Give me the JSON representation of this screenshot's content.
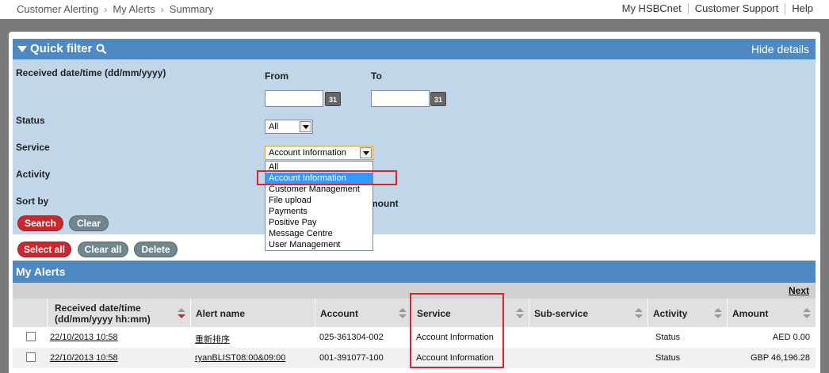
{
  "breadcrumb": [
    "Customer Alerting",
    "My Alerts",
    "Summary"
  ],
  "top_links": [
    "My HSBCnet",
    "Customer Support",
    "Help"
  ],
  "quick_filter": {
    "title": "Quick filter",
    "hide_details": "Hide details",
    "received_label": "Received date/time (dd/mm/yyyy)",
    "from_label": "From",
    "to_label": "To",
    "calendar_glyph": "31",
    "status_label": "Status",
    "status_value": "All",
    "service_label": "Service",
    "service_value": "Account Information",
    "activity_label": "Activity",
    "sort_by_label": "Sort by",
    "sort_partial_text": "mount",
    "service_options": [
      "All",
      "Account Information",
      "Customer Management",
      "File upload",
      "Payments",
      "Positive Pay",
      "Message Centre",
      "User Management"
    ],
    "selected_option_index": 1,
    "search_button": "Search",
    "clear_button": "Clear"
  },
  "actions": {
    "select_all": "Select all",
    "clear_all": "Clear all",
    "delete": "Delete"
  },
  "my_alerts": {
    "title": "My Alerts",
    "next": "Next",
    "columns": {
      "received_line1": "Received date/time",
      "received_line2": "(dd/mm/yyyy hh:mm)",
      "alert_name": "Alert name",
      "account": "Account",
      "service": "Service",
      "sub_service": "Sub-service",
      "activity": "Activity",
      "amount": "Amount"
    },
    "rows": [
      {
        "received": "22/10/2013 10:58",
        "alert_name": "重新排序",
        "account": "025-361304-002",
        "service": "Account Information",
        "sub_service": "",
        "activity": "Status",
        "amount": "AED 0.00"
      },
      {
        "received": "22/10/2013 10:58",
        "alert_name": "ryanBLIST08:00&09:00",
        "account": "001-391077-100",
        "service": "Account Information",
        "sub_service": "",
        "activity": "Status",
        "amount": "GBP 46,196.28"
      }
    ]
  },
  "colors": {
    "header_blue": "#4e89c2",
    "filter_bg": "#c1d6e8",
    "button_red": "#c8282e",
    "button_gray": "#72868f",
    "highlight_red": "#d9262e"
  }
}
